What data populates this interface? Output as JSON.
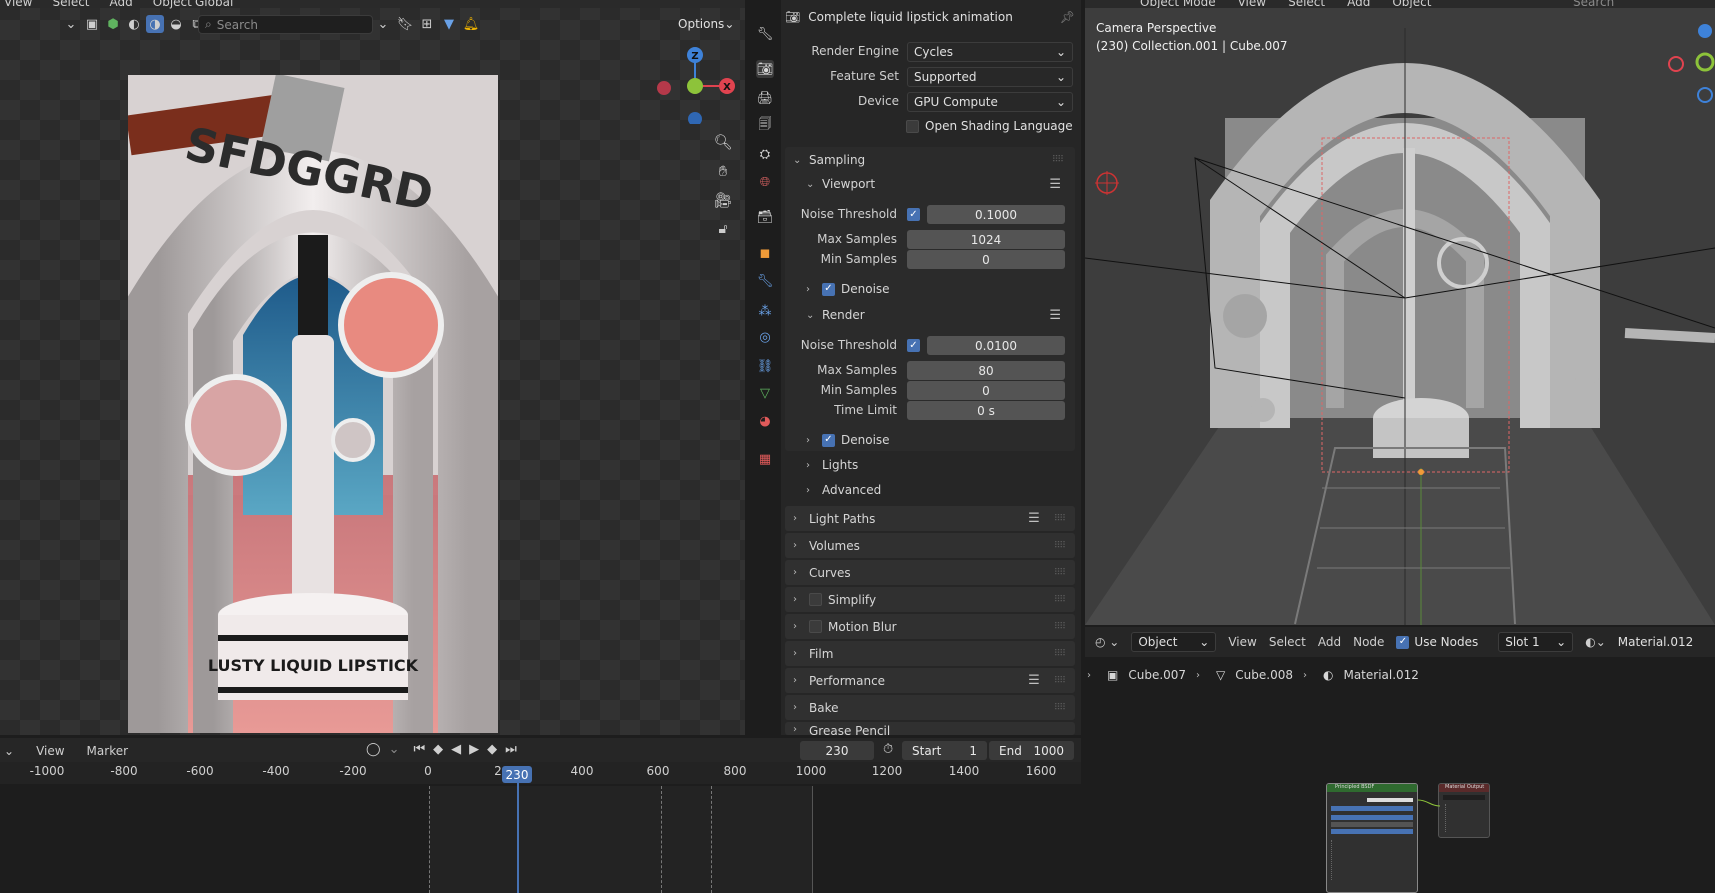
{
  "left_viewport": {
    "menu": [
      "View",
      "Select",
      "Add",
      "Object"
    ],
    "orientation": "Global",
    "search_placeholder": "Search",
    "options_label": "Options",
    "gizmo": {
      "z": "Z",
      "x": "X"
    },
    "render_text_top": "SFDGGRD",
    "render_text_base": "LUSTY LIQUID LIPSTICK"
  },
  "properties": {
    "header_title": "Complete liquid lipstick animation",
    "render_engine_label": "Render Engine",
    "render_engine_value": "Cycles",
    "feature_set_label": "Feature Set",
    "feature_set_value": "Supported",
    "device_label": "Device",
    "device_value": "GPU Compute",
    "osl_label": "Open Shading Language",
    "sampling_label": "Sampling",
    "viewport": {
      "label": "Viewport",
      "noise_threshold_label": "Noise Threshold",
      "noise_threshold_value": "0.1000",
      "max_samples_label": "Max Samples",
      "max_samples_value": "1024",
      "min_samples_label": "Min Samples",
      "min_samples_value": "0",
      "denoise_label": "Denoise"
    },
    "render": {
      "label": "Render",
      "noise_threshold_label": "Noise Threshold",
      "noise_threshold_value": "0.0100",
      "max_samples_label": "Max Samples",
      "max_samples_value": "80",
      "min_samples_label": "Min Samples",
      "min_samples_value": "0",
      "time_limit_label": "Time Limit",
      "time_limit_value": "0 s",
      "denoise_label": "Denoise"
    },
    "lights_label": "Lights",
    "advanced_label": "Advanced",
    "panels": [
      "Light Paths",
      "Volumes",
      "Curves",
      "Simplify",
      "Motion Blur",
      "Film",
      "Performance",
      "Bake",
      "Grease Pencil"
    ]
  },
  "right_viewport": {
    "mode": "Object Mode",
    "menu": [
      "View",
      "Select",
      "Add",
      "Object"
    ],
    "search_placeholder": "Search",
    "camera_label": "Camera Perspective",
    "collection_label": "(230) Collection.001 | Cube.007"
  },
  "node_editor": {
    "type": "Object",
    "menu": [
      "View",
      "Select",
      "Add",
      "Node"
    ],
    "use_nodes_label": "Use Nodes",
    "slot": "Slot 1",
    "material": "Material.012",
    "breadcrumb": [
      "Cube.007",
      "Cube.008",
      "Material.012"
    ],
    "node_bsdf_title": "Principled BSDF",
    "node_output_title": "Material Output"
  },
  "timeline": {
    "menu": [
      "View",
      "Marker"
    ],
    "current_frame": "230",
    "start_label": "Start",
    "start_value": "1",
    "end_label": "End",
    "end_value": "1000",
    "ticks": [
      "-1000",
      "-800",
      "-600",
      "-400",
      "-200",
      "0",
      "2",
      "400",
      "600",
      "800",
      "1000",
      "1200",
      "1400",
      "1600"
    ],
    "playhead_label": "230"
  },
  "colors": {
    "accent": "#4772b3",
    "panel_bg": "#303030",
    "header_bg": "#2a2a2a",
    "gizmo_x": "#e0434f",
    "gizmo_y": "#8dc33a",
    "gizmo_z": "#3e82d9"
  }
}
